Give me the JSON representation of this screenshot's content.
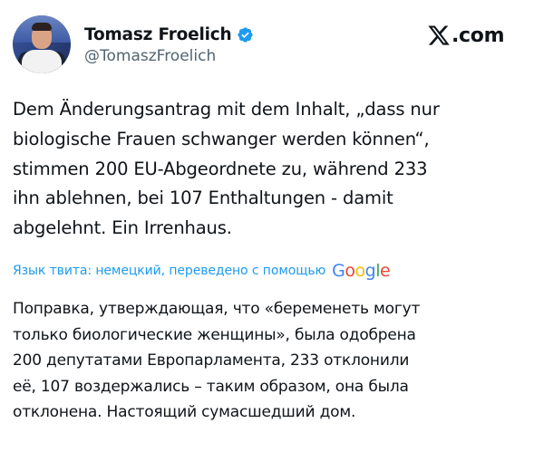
{
  "author": {
    "display_name": "Tomasz Froelich",
    "handle": "@TomaszFroelich",
    "verified_icon": "verified-badge-icon",
    "verified_color": "#1d9bf0"
  },
  "brand": {
    "logo_icon": "x-logo-icon",
    "text": ".com"
  },
  "tweet": {
    "lines": [
      "Dem Änderungsantrag mit dem Inhalt, „dass nur",
      "biologische Frauen schwanger werden können“,",
      "stimmen 200 EU-Abgeordnete zu, während 233",
      "ihn ablehnen, bei 107 Enthaltungen - damit",
      "abgelehnt. Ein Irrenhaus."
    ]
  },
  "translation_notice": {
    "label": "Язык твита: немецкий, переведено с помощью",
    "provider": {
      "letters": [
        "G",
        "o",
        "o",
        "g",
        "l",
        "e"
      ],
      "colors": [
        "#4285f4",
        "#ea4335",
        "#fbbc05",
        "#4285f4",
        "#34a853",
        "#ea4335"
      ]
    },
    "link_color": "#1d9bf0"
  },
  "translation": {
    "lines": [
      "Поправка, утверждающая, что «беременеть могут",
      "только биологические женщины», была одобрена",
      "200 депутатами Европарламента, 233 отклонили",
      "её, 107 воздержались – таким образом, она была",
      "отклонена. Настоящий сумасшедший дом."
    ]
  }
}
